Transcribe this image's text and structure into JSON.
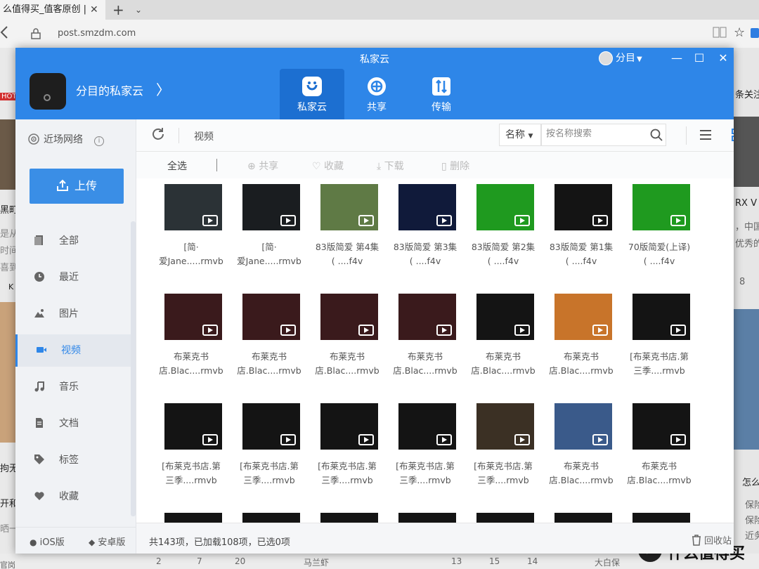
{
  "browser": {
    "tab_title": "么值得买_值客原创 |",
    "tab_close": "✕",
    "tab_add": "+",
    "tab_menu": "⌄",
    "url": "post.smzdm.com",
    "back_icon": "arrow-left-icon",
    "star": "☆"
  },
  "background": {
    "left_fragments": [
      "HOT",
      "黑町",
      "是从",
      "时间",
      "喜到",
      "K",
      "拘无",
      "开和",
      "晒一",
      "官岗"
    ],
    "right_fragments": [
      "条关注",
      "RX V",
      "，中国",
      "优秀的",
      "8",
      "怎么",
      "保险",
      "保险",
      "近务"
    ],
    "bottom_items": [
      "2",
      "7",
      "20",
      "马兰虾",
      "13",
      "15",
      "14",
      "大白保"
    ],
    "brand_logo": "值",
    "brand_name": "什么值得买"
  },
  "window": {
    "title": "私家云",
    "user_name": "分目",
    "cloud_name": "分目的私家云",
    "cloud_arrow": "〉",
    "nav": [
      {
        "label": "私家云",
        "icon": "cloud-face-icon",
        "active": true
      },
      {
        "label": "共享",
        "icon": "share-icon",
        "active": false
      },
      {
        "label": "传输",
        "icon": "transfer-icon",
        "active": false
      }
    ],
    "minimize": "—",
    "maximize": "☐",
    "close": "✕"
  },
  "sidebar": {
    "nearby": "近场网络",
    "upload": "上传",
    "items": [
      {
        "label": "全部",
        "icon": "file-icon",
        "active": false
      },
      {
        "label": "最近",
        "icon": "clock-icon",
        "active": false
      },
      {
        "label": "图片",
        "icon": "image-icon",
        "active": false
      },
      {
        "label": "视频",
        "icon": "video-icon",
        "active": true
      },
      {
        "label": "音乐",
        "icon": "music-icon",
        "active": false
      },
      {
        "label": "文档",
        "icon": "document-icon",
        "active": false
      },
      {
        "label": "标签",
        "icon": "tag-icon",
        "active": false
      },
      {
        "label": "收藏",
        "icon": "heart-icon",
        "active": false
      }
    ],
    "ios": "iOS版",
    "android": "安卓版"
  },
  "toolbar": {
    "breadcrumb": "视频",
    "sort_label": "名称",
    "search_placeholder": "按名称搜索"
  },
  "actions": {
    "select_all": "全选",
    "share": "共享",
    "favorite": "收藏",
    "download": "下载",
    "delete": "删除"
  },
  "files": [
    {
      "line1": "[简·",
      "line2": "爱Jane.....rmvb",
      "thumb": "#2b3236"
    },
    {
      "line1": "[简·",
      "line2": "爱Jane.....rmvb",
      "thumb": "#1a1d20"
    },
    {
      "line1": "83版简爱 第4集",
      "line2": "( ....f4v",
      "thumb": "#5f7a45"
    },
    {
      "line1": "83版简爱 第3集",
      "line2": "( ....f4v",
      "thumb": "#101a3a"
    },
    {
      "line1": "83版简爱 第2集",
      "line2": "( ....f4v",
      "thumb": "#1f9a1f"
    },
    {
      "line1": "83版简爱 第1集",
      "line2": "( ....f4v",
      "thumb": "#141414"
    },
    {
      "line1": "70版简爱(上译)",
      "line2": "( ....f4v",
      "thumb": "#1f9a1f"
    },
    {
      "line1": "布莱克书",
      "line2": "店.Blac....rmvb",
      "thumb": "#3a1a1c"
    },
    {
      "line1": "布莱克书",
      "line2": "店.Blac....rmvb",
      "thumb": "#3a1a1c"
    },
    {
      "line1": "布莱克书",
      "line2": "店.Blac....rmvb",
      "thumb": "#3a1a1c"
    },
    {
      "line1": "布莱克书",
      "line2": "店.Blac....rmvb",
      "thumb": "#3a1a1c"
    },
    {
      "line1": "布莱克书",
      "line2": "店.Blac....rmvb",
      "thumb": "#141414"
    },
    {
      "line1": "布莱克书",
      "line2": "店.Blac....rmvb",
      "thumb": "#c8742a"
    },
    {
      "line1": "[布莱克书店.第",
      "line2": "三季....rmvb",
      "thumb": "#141414"
    },
    {
      "line1": "[布莱克书店.第",
      "line2": "三季....rmvb",
      "thumb": "#141414"
    },
    {
      "line1": "[布莱克书店.第",
      "line2": "三季....rmvb",
      "thumb": "#141414"
    },
    {
      "line1": "[布莱克书店.第",
      "line2": "三季....rmvb",
      "thumb": "#141414"
    },
    {
      "line1": "[布莱克书店.第",
      "line2": "三季....rmvb",
      "thumb": "#141414"
    },
    {
      "line1": "[布莱克书店.第",
      "line2": "三季....rmvb",
      "thumb": "#3b3024"
    },
    {
      "line1": "布莱克书",
      "line2": "店.Blac....rmvb",
      "thumb": "#3a5a8a"
    },
    {
      "line1": "布莱克书",
      "line2": "店.Blac....rmvb",
      "thumb": "#141414"
    }
  ],
  "status": {
    "summary": "共143项，已加载108项，已选0项",
    "recycle": "回收站"
  },
  "colors": {
    "brand_blue": "#2e86e8",
    "active_tab": "#1c6fd1",
    "upload_button": "#3a8ee6"
  }
}
